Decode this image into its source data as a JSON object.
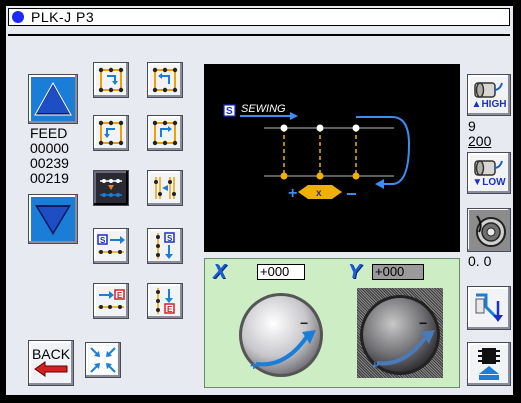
{
  "title": "PLK-J P3",
  "feed": {
    "label": "FEED",
    "values": [
      "00000",
      "00239",
      "00219"
    ]
  },
  "preview": {
    "badge": "S",
    "caption": "SEWING",
    "plus": "+",
    "minus": "−",
    "cross": "x"
  },
  "jog": {
    "x_axis": "X",
    "y_axis": "Y",
    "x_value": "+000",
    "y_value": "+000",
    "plus": "+",
    "minus": "−"
  },
  "right": {
    "high_label": "HIGH",
    "low_label": "LOW",
    "speed_level": "9",
    "speed_value": "200",
    "tension_value": "0. 0"
  },
  "buttons": {
    "back_label": "BACK",
    "s_badge": "S",
    "e_badge": "E"
  },
  "colors": {
    "accent_blue": "#1a7dd8",
    "preview_yellow": "#f0b000",
    "jog_green": "#cdeec5",
    "back_red": "#d42020"
  }
}
